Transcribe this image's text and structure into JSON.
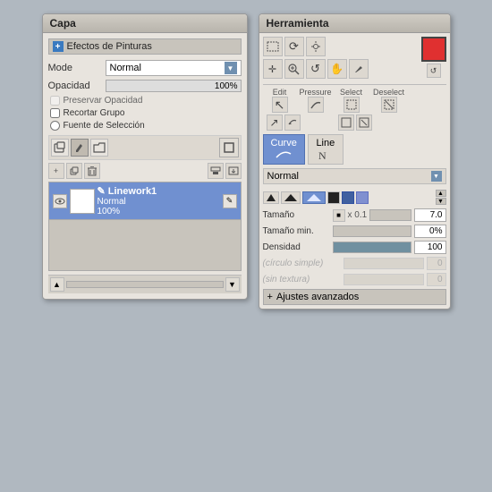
{
  "capa": {
    "title": "Capa",
    "effects_label": "Efectos de Pinturas",
    "mode_label": "Mode",
    "mode_value": "Normal",
    "opacity_label": "Opacidad",
    "opacity_value": "100%",
    "preserve_opacity": "Preservar Opacidad",
    "clip_group": "Recortar Grupo",
    "selection_source": "Fuente de Selección",
    "layer_name": "✎ Linework1",
    "layer_mode": "Normal",
    "layer_opacity": "100%"
  },
  "herramienta": {
    "title": "Herramienta",
    "edit_label": "Edit",
    "pressure_label": "Pressure",
    "select_label": "Select",
    "deselect_label": "Deselect",
    "curve_label": "Curve",
    "line_label": "Line",
    "normal_label": "Normal",
    "size_label": "Tamaño",
    "size_multiplier": "x 0.1",
    "size_value": "7.0",
    "size_min_label": "Tamaño min.",
    "size_min_value": "0%",
    "density_label": "Densidad",
    "density_value": "100",
    "circle_label": "(círculo simple)",
    "circle_value": "0",
    "texture_label": "(sin textura)",
    "texture_value": "0",
    "ajustes_label": "Ajustes avanzados"
  }
}
